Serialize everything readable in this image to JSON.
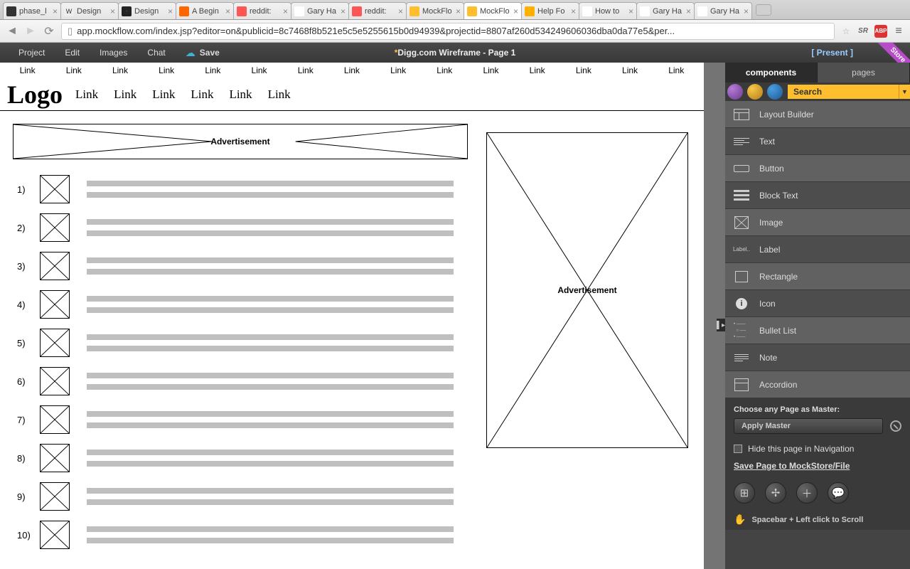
{
  "browser": {
    "tabs": [
      {
        "favicon": "#333",
        "fchar": "",
        "label": "phase_l"
      },
      {
        "favicon": "#eee",
        "fchar": "W",
        "label": "Design"
      },
      {
        "favicon": "#222",
        "fchar": "⦿",
        "label": "Design"
      },
      {
        "favicon": "#f60",
        "fchar": "",
        "label": "A Begin"
      },
      {
        "favicon": "#f55",
        "fchar": "",
        "label": "reddit:"
      },
      {
        "favicon": "#fff",
        "fchar": "",
        "label": "Gary Ha"
      },
      {
        "favicon": "#f55",
        "fchar": "",
        "label": "reddit:"
      },
      {
        "favicon": "#ffbe2e",
        "fchar": "",
        "label": "MockFlo"
      },
      {
        "favicon": "#ffbe2e",
        "fchar": "",
        "label": "MockFlo",
        "active": true
      },
      {
        "favicon": "#ffb000",
        "fchar": "",
        "label": "Help Fo"
      },
      {
        "favicon": "#fff",
        "fchar": "",
        "label": "How to"
      },
      {
        "favicon": "#fff",
        "fchar": "",
        "label": "Gary Ha"
      },
      {
        "favicon": "#fff",
        "fchar": "",
        "label": "Gary Ha"
      }
    ],
    "url": "app.mockflow.com/index.jsp?editor=on&publicid=8c7468f8b521e5c5e5255615b0d94939&projectid=8807af260d534249606036dba0da77e5&per..."
  },
  "appbar": {
    "menu": [
      "Project",
      "Edit",
      "Images",
      "Chat"
    ],
    "save": "Save",
    "title": "Digg.com Wireframe - Page 1",
    "present": "[ Present ]",
    "store": "Store"
  },
  "canvas": {
    "toplink": "Link",
    "toplinks_count": 15,
    "logo": "Logo",
    "logolinks_count": 6,
    "ad": "Advertisement",
    "list_count": 10
  },
  "panel": {
    "tabs": {
      "components": "components",
      "pages": "pages"
    },
    "search": "Search",
    "components": [
      "Layout Builder",
      "Text",
      "Button",
      "Block Text",
      "Image",
      "Label",
      "Rectangle",
      "Icon",
      "Bullet List",
      "Note",
      "Accordion"
    ],
    "master_label": "Choose any Page as Master:",
    "apply_master": "Apply Master",
    "hide_nav": "Hide this page in Navigation",
    "save_link": "Save Page to MockStore/File",
    "hint": "Spacebar + Left click to Scroll"
  }
}
